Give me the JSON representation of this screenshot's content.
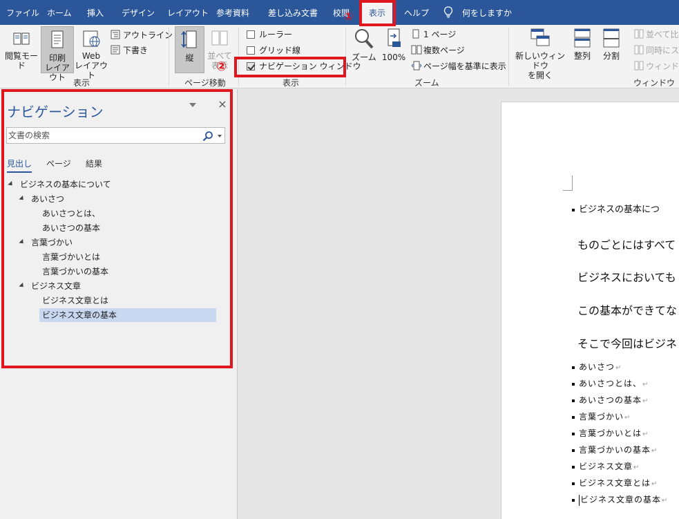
{
  "ribbon_tabs": [
    "ファイル",
    "ホーム",
    "挿入",
    "デザイン",
    "レイアウト",
    "参考資料",
    "差し込み文書",
    "校閲",
    "表示",
    "ヘルプ"
  ],
  "tell_me": "何をしますか",
  "ribbon": {
    "views": {
      "read_mode": "閲覧モード",
      "print_layout": "印刷\nレイアウト",
      "web_layout": "Web\nレイアウト",
      "outline": "アウトライン",
      "draft": "下書き",
      "label": "表示"
    },
    "page_move": {
      "vertical": "縦",
      "side_by_side": "並べて\n表示",
      "label": "ページ移動"
    },
    "show": {
      "ruler": "ルーラー",
      "gridlines": "グリッド線",
      "navigation_pane": "ナビゲーション ウィンドウ",
      "ruler_checked": false,
      "gridlines_checked": false,
      "navigation_checked": true,
      "label": "表示"
    },
    "zoom": {
      "zoom": "ズーム",
      "percent": "100%",
      "one_page": "1 ページ",
      "multiple_pages": "複数ページ",
      "page_width": "ページ幅を基準に表示",
      "label": "ズーム"
    },
    "window": {
      "new_window": "新しいウィンドウ\nを開く",
      "arrange": "整列",
      "split": "分割",
      "side_by_side": "並べて比較",
      "sync_scroll": "同時にスクロール",
      "reset_pos": "ウィンドウの位置",
      "label": "ウィンドウ"
    }
  },
  "annotations": {
    "mark1": "①",
    "mark2": "②"
  },
  "nav": {
    "title": "ナビゲーション",
    "close": "×",
    "search_placeholder": "文書の検索",
    "tabs": [
      "見出し",
      "ページ",
      "結果"
    ],
    "tree": [
      {
        "label": "ビジネスの基本について",
        "level": 0,
        "expanded": true,
        "selected": false
      },
      {
        "label": "あいさつ",
        "level": 1,
        "expanded": true,
        "selected": false
      },
      {
        "label": "あいさつとは、",
        "level": 2,
        "expanded": false,
        "selected": false
      },
      {
        "label": "あいさつの基本",
        "level": 2,
        "expanded": false,
        "selected": false
      },
      {
        "label": "言葉づかい",
        "level": 1,
        "expanded": true,
        "selected": false
      },
      {
        "label": "言葉づかいとは",
        "level": 2,
        "expanded": false,
        "selected": false
      },
      {
        "label": "言葉づかいの基本",
        "level": 2,
        "expanded": false,
        "selected": false
      },
      {
        "label": "ビジネス文章",
        "level": 1,
        "expanded": true,
        "selected": false
      },
      {
        "label": "ビジネス文章とは",
        "level": 2,
        "expanded": false,
        "selected": false
      },
      {
        "label": "ビジネス文章の基本",
        "level": 2,
        "expanded": false,
        "selected": true
      }
    ]
  },
  "document": {
    "heading": "ビジネスの基本につ",
    "paragraphs": [
      "ものごとにはすべて",
      "ビジネスにおいても",
      "この基本ができてな",
      "そこで今回はビジネ"
    ],
    "list": [
      "あいさつ",
      "あいさつとは、",
      "あいさつの基本",
      "言葉づかい",
      "言葉づかいとは",
      "言葉づかいの基本",
      "ビジネス文章",
      "ビジネス文章とは",
      "ビジネス文章の基本"
    ]
  }
}
